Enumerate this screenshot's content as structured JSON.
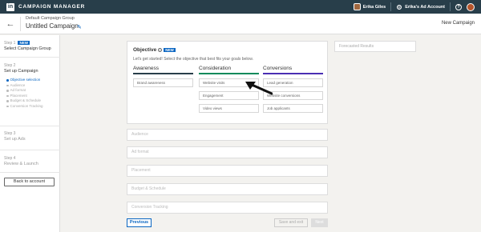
{
  "topbar": {
    "brand": "CAMPAIGN MANAGER",
    "logo": "in",
    "user_name": "Erika Giles",
    "account_name": "Erika's Ad Account",
    "help_label": "?"
  },
  "header": {
    "group_name": "Default Campaign Group",
    "campaign_name": "Untitled Campaign",
    "new_campaign": "New Campaign"
  },
  "sidebar": {
    "step1": {
      "label": "Step 1",
      "badge": "NEW",
      "title": "Select Campaign Group"
    },
    "step2": {
      "label": "Step 2",
      "title": "Set up Campaign"
    },
    "substeps": [
      {
        "label": "Objective selection",
        "active": true
      },
      {
        "label": "Audience",
        "active": false
      },
      {
        "label": "Ad format",
        "active": false
      },
      {
        "label": "Placement",
        "active": false
      },
      {
        "label": "Budget & Schedule",
        "active": false
      },
      {
        "label": "Conversion Tracking",
        "active": false
      }
    ],
    "step3": {
      "label": "Step 3",
      "title": "Set up Ads"
    },
    "step4": {
      "label": "Step 4",
      "title": "Review & Launch"
    },
    "back_button": "Back to account"
  },
  "objective": {
    "title": "Objective",
    "badge": "NEW",
    "description": "Let's get started! Select the objective that best fits your goals below.",
    "columns": [
      {
        "heading": "Awareness",
        "color": "#283e4a",
        "options": [
          "Brand awareness"
        ]
      },
      {
        "heading": "Consideration",
        "color": "#0b8a5b",
        "options": [
          "Website visits",
          "Engagement",
          "Video views"
        ]
      },
      {
        "heading": "Conversions",
        "color": "#4a2fb3",
        "options": [
          "Lead generation",
          "Website conversions",
          "Job applicants"
        ]
      }
    ]
  },
  "forecast": {
    "label": "Forecasted Results"
  },
  "sections": [
    "Audience",
    "Ad format",
    "Placement",
    "Budget & Schedule",
    "Conversion Tracking"
  ],
  "footer": {
    "previous": "Previous",
    "save_exit": "Save and exit",
    "next": "Next"
  },
  "icons": {
    "back": "arrow-left-icon",
    "edit": "pencil-icon",
    "info": "info-icon",
    "pointer": "arrow-pointer-icon"
  }
}
